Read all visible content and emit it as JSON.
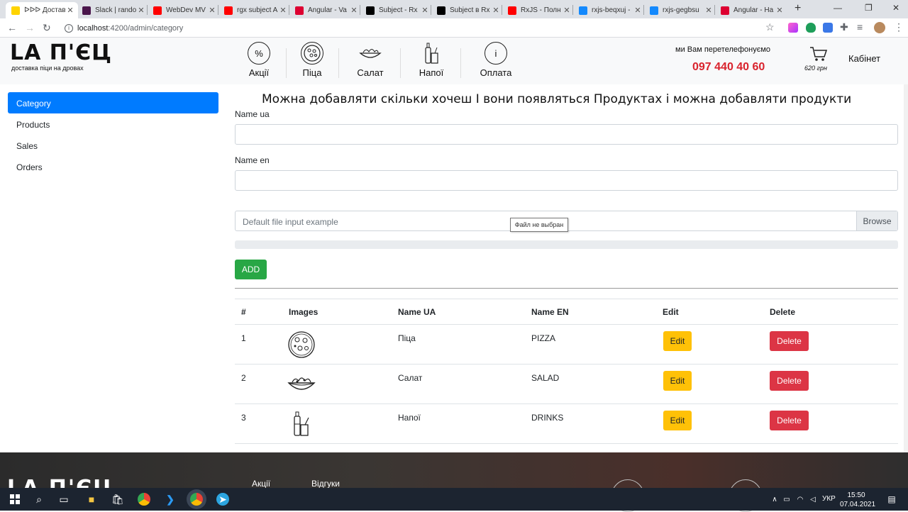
{
  "browser": {
    "tabs": [
      {
        "title": "ᐅᐅᐅ Достав",
        "icon": "lapec-favicon",
        "color": "#ffd400",
        "active": true
      },
      {
        "title": "Slack | rando",
        "icon": "slack-icon",
        "color": "#4a154b"
      },
      {
        "title": "WebDev MV",
        "icon": "youtube-icon",
        "color": "#ff0000"
      },
      {
        "title": "rgx subject A",
        "icon": "youtube-icon",
        "color": "#ff0000"
      },
      {
        "title": "Angular - Va",
        "icon": "angular-icon",
        "color": "#dd0031"
      },
      {
        "title": "Subject - Rx",
        "icon": "dev-icon",
        "color": "#000000"
      },
      {
        "title": "Subject в Rx",
        "icon": "medium-icon",
        "color": "#000000"
      },
      {
        "title": "RxJS - Полн",
        "icon": "youtube-icon",
        "color": "#ff0000"
      },
      {
        "title": "rxjs-beqxuj -",
        "icon": "stackblitz-icon",
        "color": "#1389fd"
      },
      {
        "title": "rxjs-gegbsu",
        "icon": "stackblitz-icon",
        "color": "#1389fd"
      },
      {
        "title": "Angular - Ha",
        "icon": "angular-icon",
        "color": "#dd0031"
      }
    ],
    "url_host": "localhost",
    "url_path": ":4200/admin/category"
  },
  "header": {
    "logo": "LA П'ЄЦ",
    "logo_sub": "доставка піци на дровах",
    "menu": [
      {
        "label": "Акції",
        "icon": "percent-icon"
      },
      {
        "label": "Піца",
        "icon": "pizza-icon"
      },
      {
        "label": "Салат",
        "icon": "salad-icon"
      },
      {
        "label": "Напої",
        "icon": "drinks-icon"
      },
      {
        "label": "Оплата",
        "icon": "info-icon"
      }
    ],
    "callback": "ми Вам перетелефонуємо",
    "phone": "097 440 40 60",
    "cart_price": "620 грн",
    "cabinet": "Кабінет"
  },
  "sidebar": {
    "items": [
      "Category",
      "Products",
      "Sales",
      "Orders"
    ],
    "active": "Category"
  },
  "main": {
    "title": "Можна добавляти скільки хочеш І вони появляться Продуктах і можна добавляти продукти",
    "name_ua_label": "Name ua",
    "name_en_label": "Name en",
    "file_placeholder": "Default file input example",
    "browse": "Browse",
    "file_tooltip": "Файл не выбран",
    "add": "ADD"
  },
  "table": {
    "headers": [
      "#",
      "Images",
      "Name UA",
      "Name EN",
      "Edit",
      "Delete"
    ],
    "rows": [
      {
        "num": "1",
        "icon": "pizza-icon",
        "name_ua": "Піца",
        "name_en": "PIZZA",
        "edit": "Edit",
        "delete": "Delete"
      },
      {
        "num": "2",
        "icon": "salad-icon",
        "name_ua": "Салат",
        "name_en": "SALAD",
        "edit": "Edit",
        "delete": "Delete"
      },
      {
        "num": "3",
        "icon": "drinks-icon",
        "name_ua": "Напої",
        "name_en": "DRINKS",
        "edit": "Edit",
        "delete": "Delete"
      }
    ]
  },
  "footer": {
    "logo": "LA П'ЄЦ",
    "links": [
      "Акції",
      "Відгуки"
    ]
  },
  "taskbar": {
    "lang": "УКР",
    "time": "15:50",
    "date": "07.04.2021"
  },
  "colors": {
    "primary": "#007bff",
    "success": "#28a745",
    "warning": "#ffc107",
    "danger": "#dc3545",
    "phone": "#d9232d"
  }
}
